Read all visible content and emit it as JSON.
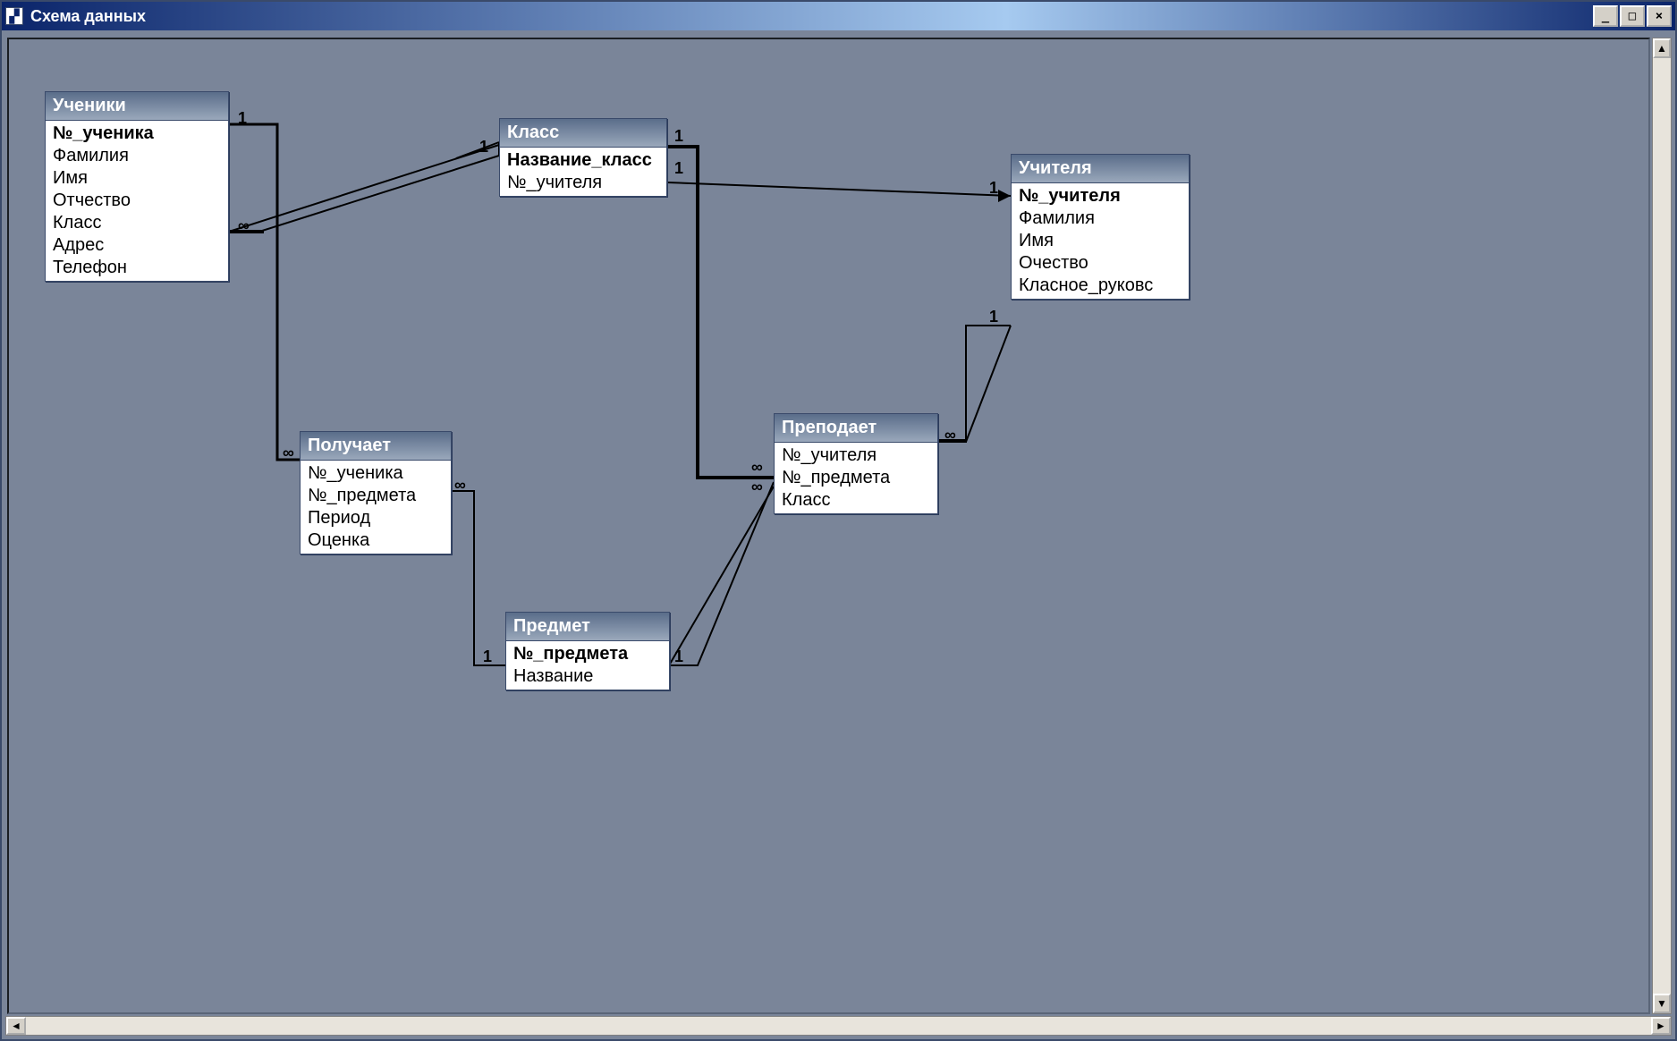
{
  "window": {
    "title": "Схема данных"
  },
  "tables": {
    "ucheniki": {
      "title": "Ученики",
      "fields": [
        "№_ученика",
        "Фамилия",
        "Имя",
        "Отчество",
        "Класс",
        "Адрес",
        "Телефон"
      ],
      "pk": [
        0
      ]
    },
    "klass": {
      "title": "Класс",
      "fields": [
        "Название_класс",
        "№_учителя"
      ],
      "pk": [
        0
      ]
    },
    "uchitelya": {
      "title": "Учителя",
      "fields": [
        "№_учителя",
        "Фамилия",
        "Имя",
        "Очество",
        "Класное_руковс"
      ],
      "pk": [
        0
      ]
    },
    "poluchaet": {
      "title": "Получает",
      "fields": [
        "№_ученика",
        "№_предмета",
        "Период",
        "Оценка"
      ],
      "pk": []
    },
    "predmet": {
      "title": "Предмет",
      "fields": [
        "№_предмета",
        "Название"
      ],
      "pk": [
        0
      ]
    },
    "prepodaet": {
      "title": "Преподает",
      "fields": [
        "№_учителя",
        "№_предмета",
        "Класс"
      ],
      "pk": []
    }
  },
  "relations": [
    {
      "from": "ucheniki",
      "to": "poluchaet",
      "from_card": "1",
      "to_card": "∞"
    },
    {
      "from": "ucheniki",
      "to": "klass",
      "from_card": "∞",
      "to_card": "1"
    },
    {
      "from": "klass",
      "to": "uchitelya",
      "from_card": "1",
      "to_card": "1"
    },
    {
      "from": "klass",
      "to": "prepodaet",
      "from_card": "1",
      "to_card": "∞"
    },
    {
      "from": "predmet",
      "to": "poluchaet",
      "from_card": "1",
      "to_card": "∞"
    },
    {
      "from": "predmet",
      "to": "prepodaet",
      "from_card": "1",
      "to_card": "∞"
    },
    {
      "from": "uchitelya",
      "to": "prepodaet",
      "from_card": "1",
      "to_card": "∞"
    }
  ]
}
